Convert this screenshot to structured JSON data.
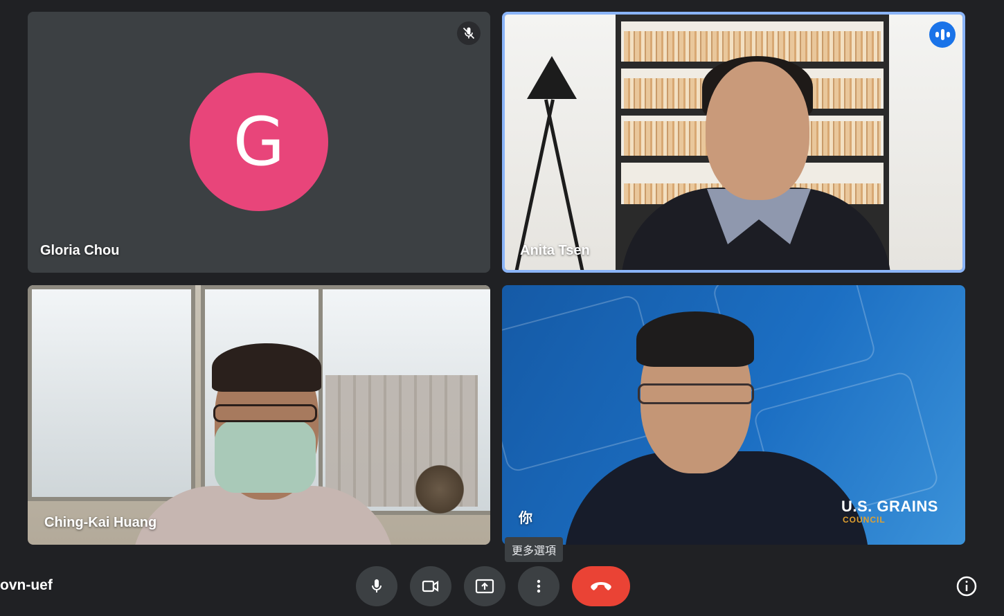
{
  "meeting": {
    "code": "ovn-uef"
  },
  "participants": [
    {
      "name": "Gloria Chou",
      "initial": "G",
      "avatar_color": "#e8457a",
      "muted": true,
      "camera": false
    },
    {
      "name": "Anita Tsen",
      "speaking": true,
      "camera": true
    },
    {
      "name": "Ching-Kai Huang",
      "camera": true
    },
    {
      "name": "你",
      "camera": true,
      "background_brand": "U.S. GRAINS",
      "background_brand_sub": "COUNCIL"
    }
  ],
  "tooltip": {
    "more_options": "更多選項"
  },
  "controls": {
    "mic": "mic-icon",
    "camera": "videocam-icon",
    "present": "present-screen-icon",
    "more": "more-vert-icon",
    "leave": "end-call-icon",
    "info": "info-icon"
  },
  "colors": {
    "background": "#202124",
    "tile": "#3c4043",
    "active_speaker_border": "#8ab4f8",
    "end_call": "#ea4335"
  }
}
